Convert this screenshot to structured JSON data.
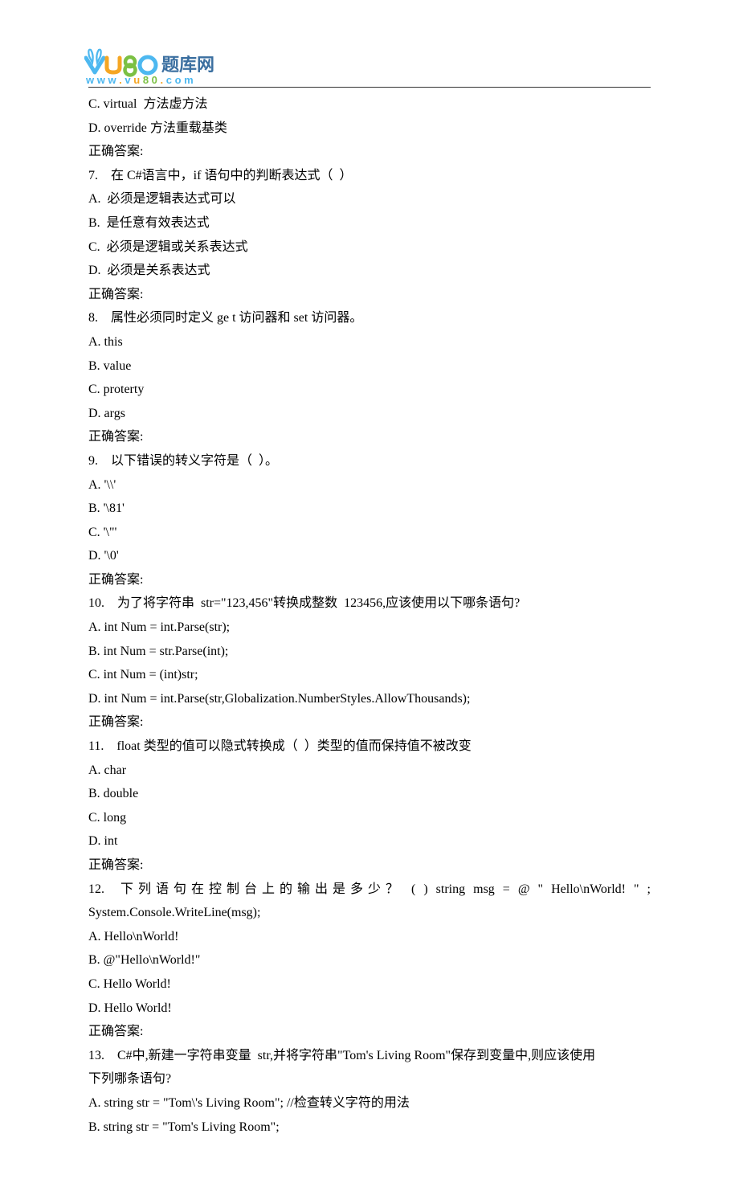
{
  "logo": {
    "brand_cn": "题库网",
    "brand_url": "www.vu80.com"
  },
  "lines": [
    {
      "text": "C. virtual  方法虚方法"
    },
    {
      "text": "D. override 方法重载基类"
    },
    {
      "text": "正确答案:"
    },
    {
      "text": "7.    在 C#语言中，if 语句中的判断表达式（  ）"
    },
    {
      "text": "A.  必须是逻辑表达式可以"
    },
    {
      "text": "B.  是任意有效表达式"
    },
    {
      "text": "C.  必须是逻辑或关系表达式"
    },
    {
      "text": "D.  必须是关系表达式"
    },
    {
      "text": "正确答案:"
    },
    {
      "text": "8.    属性必须同时定义 ge t 访问器和 set 访问器。"
    },
    {
      "text": "A. this"
    },
    {
      "text": "B. value"
    },
    {
      "text": "C. proterty"
    },
    {
      "text": "D. args"
    },
    {
      "text": "正确答案:"
    },
    {
      "text": "9.    以下错误的转义字符是（  ）。"
    },
    {
      "text": "A. '\\\\'"
    },
    {
      "text": "B. '\\81'"
    },
    {
      "text": "C. '\\\"'"
    },
    {
      "text": "D. '\\0'"
    },
    {
      "text": "正确答案:"
    },
    {
      "text": "10.    为了将字符串  str=\"123,456\"转换成整数  123456,应该使用以下哪条语句?"
    },
    {
      "text": "A. int Num = int.Parse(str);"
    },
    {
      "text": "B. int Num = str.Parse(int);"
    },
    {
      "text": "C. int Num = (int)str;"
    },
    {
      "text": "D. int Num = int.Parse(str,Globalization.NumberStyles.AllowThousands);"
    },
    {
      "text": "正确答案:"
    },
    {
      "text": "11.    float 类型的值可以隐式转换成（  ）类型的值而保持值不被改变"
    },
    {
      "text": "A. char"
    },
    {
      "text": "B. double"
    },
    {
      "text": "C. long"
    },
    {
      "text": "D. int"
    },
    {
      "text": "正确答案:"
    },
    {
      "text": "12.  下列语句在控制台上的输出是多少？ ( ) string msg = @ \" Hello\\nWorld! \" ;",
      "justified": true
    },
    {
      "text": "System.Console.WriteLine(msg);"
    },
    {
      "text": "A. Hello\\nWorld!"
    },
    {
      "text": "B. @\"Hello\\nWorld!\""
    },
    {
      "text": "C. Hello World!"
    },
    {
      "text": "D. Hello World!"
    },
    {
      "text": "正确答案:"
    },
    {
      "text": "13.    C#中,新建一字符串变量  str,并将字符串\"Tom's Living Room\"保存到变量中,则应该使用"
    },
    {
      "text": "下列哪条语句?"
    },
    {
      "text": "A. string str = \"Tom\\'s Living Room\"; //检查转义字符的用法"
    },
    {
      "text": "B. string str = \"Tom's Living Room\";"
    }
  ]
}
